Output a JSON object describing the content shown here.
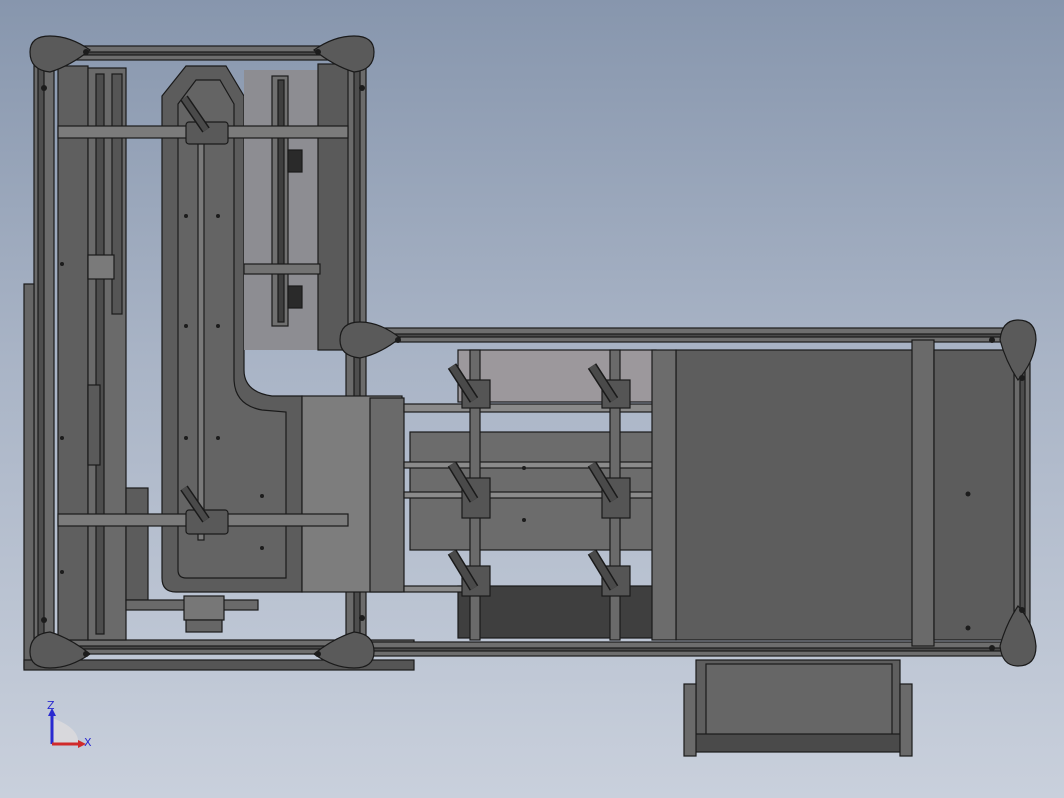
{
  "viewport": {
    "background_top": "#8796ad",
    "background_bottom": "#c9d0dc"
  },
  "model": {
    "edge_color": "#1a1a1a",
    "frame_color": "#6a6a6a",
    "plate_color": "#5e5e5e",
    "light_panel_color": "#9b979b"
  },
  "triad": {
    "z_label": "Z",
    "x_label": "X",
    "z_color": "#2a2ad0",
    "x_color": "#d02a2a"
  }
}
